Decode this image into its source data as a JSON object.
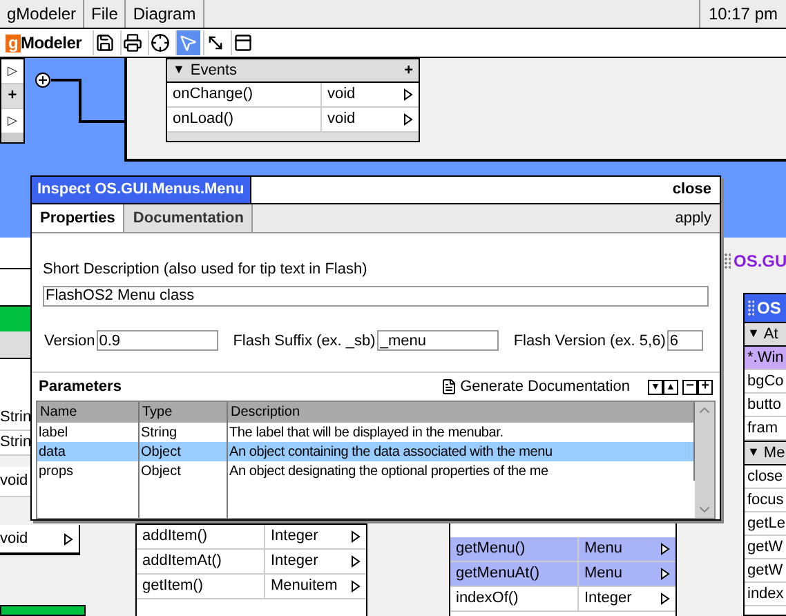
{
  "menubar": {
    "items": [
      "gModeler",
      "File",
      "Diagram"
    ],
    "clock": "10:17 pm"
  },
  "toolbar": {
    "logo": {
      "mark": "g",
      "text": "Modeler"
    },
    "tools": [
      {
        "kind": "save",
        "selected": false
      },
      {
        "kind": "print",
        "selected": false
      },
      {
        "kind": "target",
        "selected": false
      },
      {
        "kind": "pointer",
        "selected": true
      },
      {
        "kind": "resize",
        "selected": false
      },
      {
        "kind": "window",
        "selected": false
      }
    ]
  },
  "canvas": {
    "left_strip": [
      {
        "kind": "expander",
        "symbol": "▷"
      },
      {
        "kind": "add",
        "symbol": "+"
      },
      {
        "kind": "expander",
        "symbol": "▷"
      }
    ],
    "events_box": {
      "toggle": "▼",
      "title": "Events",
      "add": "+",
      "rows": [
        {
          "name": "onChange()",
          "type": "void"
        },
        {
          "name": "onLoad()",
          "type": "void"
        }
      ]
    },
    "left_column": {
      "rows": [
        "Strin",
        "Strin",
        "void"
      ],
      "box_row": "void"
    },
    "methods_box_a": {
      "rows": [
        {
          "name": "addItem()",
          "type": "Integer",
          "selected": false
        },
        {
          "name": "addItemAt()",
          "type": "Integer",
          "selected": false
        },
        {
          "name": "getItem()",
          "type": "Menuitem",
          "selected": false
        }
      ]
    },
    "methods_box_b": {
      "rows": [
        {
          "name": "getMenu()",
          "type": "Menu",
          "selected": true
        },
        {
          "name": "getMenuAt()",
          "type": "Menu",
          "selected": true
        },
        {
          "name": "indexOf()",
          "type": "Integer",
          "selected": false
        }
      ]
    },
    "right_header": "OS.GU",
    "right_class": {
      "title": "OS",
      "sections": [
        {
          "toggle": "▼",
          "title": "At",
          "rows": [
            {
              "name": "*.Win",
              "selected": true
            },
            {
              "name": "bgCo",
              "selected": false
            },
            {
              "name": "butto",
              "selected": false
            },
            {
              "name": "fram",
              "selected": false
            }
          ]
        },
        {
          "toggle": "▼",
          "title": "Me",
          "rows": [
            {
              "name": "close",
              "selected": false
            },
            {
              "name": "focus",
              "selected": false
            },
            {
              "name": "getLe",
              "selected": false
            },
            {
              "name": "getW",
              "selected": false
            },
            {
              "name": "getW",
              "selected": false
            },
            {
              "name": "index",
              "selected": false
            }
          ]
        }
      ]
    }
  },
  "dialog": {
    "title": "Inspect OS.GUI.Menus.Menu",
    "close": "close",
    "tabs": [
      {
        "label": "Properties",
        "selected": true
      },
      {
        "label": "Documentation",
        "selected": false
      }
    ],
    "apply": "apply",
    "short_description": {
      "label": "Short Description (also used for tip text in Flash)",
      "value": "FlashOS2 Menu class"
    },
    "fields": [
      {
        "label": "Version",
        "value": "0.9"
      },
      {
        "label": "Flash Suffix (ex. _sb)",
        "value": "_menu"
      },
      {
        "label": "Flash Version (ex. 5,6)",
        "value": "6"
      }
    ],
    "parameters": {
      "title": "Parameters",
      "generate": "Generate Documentation",
      "order_buttons": [
        "▼",
        "▲"
      ],
      "count_buttons": [
        "−",
        "+"
      ],
      "columns": [
        "Name",
        "Type",
        "Description"
      ],
      "rows": [
        {
          "cells": [
            "label",
            "String",
            "The label that will be displayed in the menubar."
          ],
          "selected": false
        },
        {
          "cells": [
            "data",
            "Object",
            "An object containing the data associated with the menu"
          ],
          "selected": true
        },
        {
          "cells": [
            "props",
            "Object",
            "An object designating the optional properties of the me"
          ],
          "selected": false
        }
      ]
    }
  }
}
